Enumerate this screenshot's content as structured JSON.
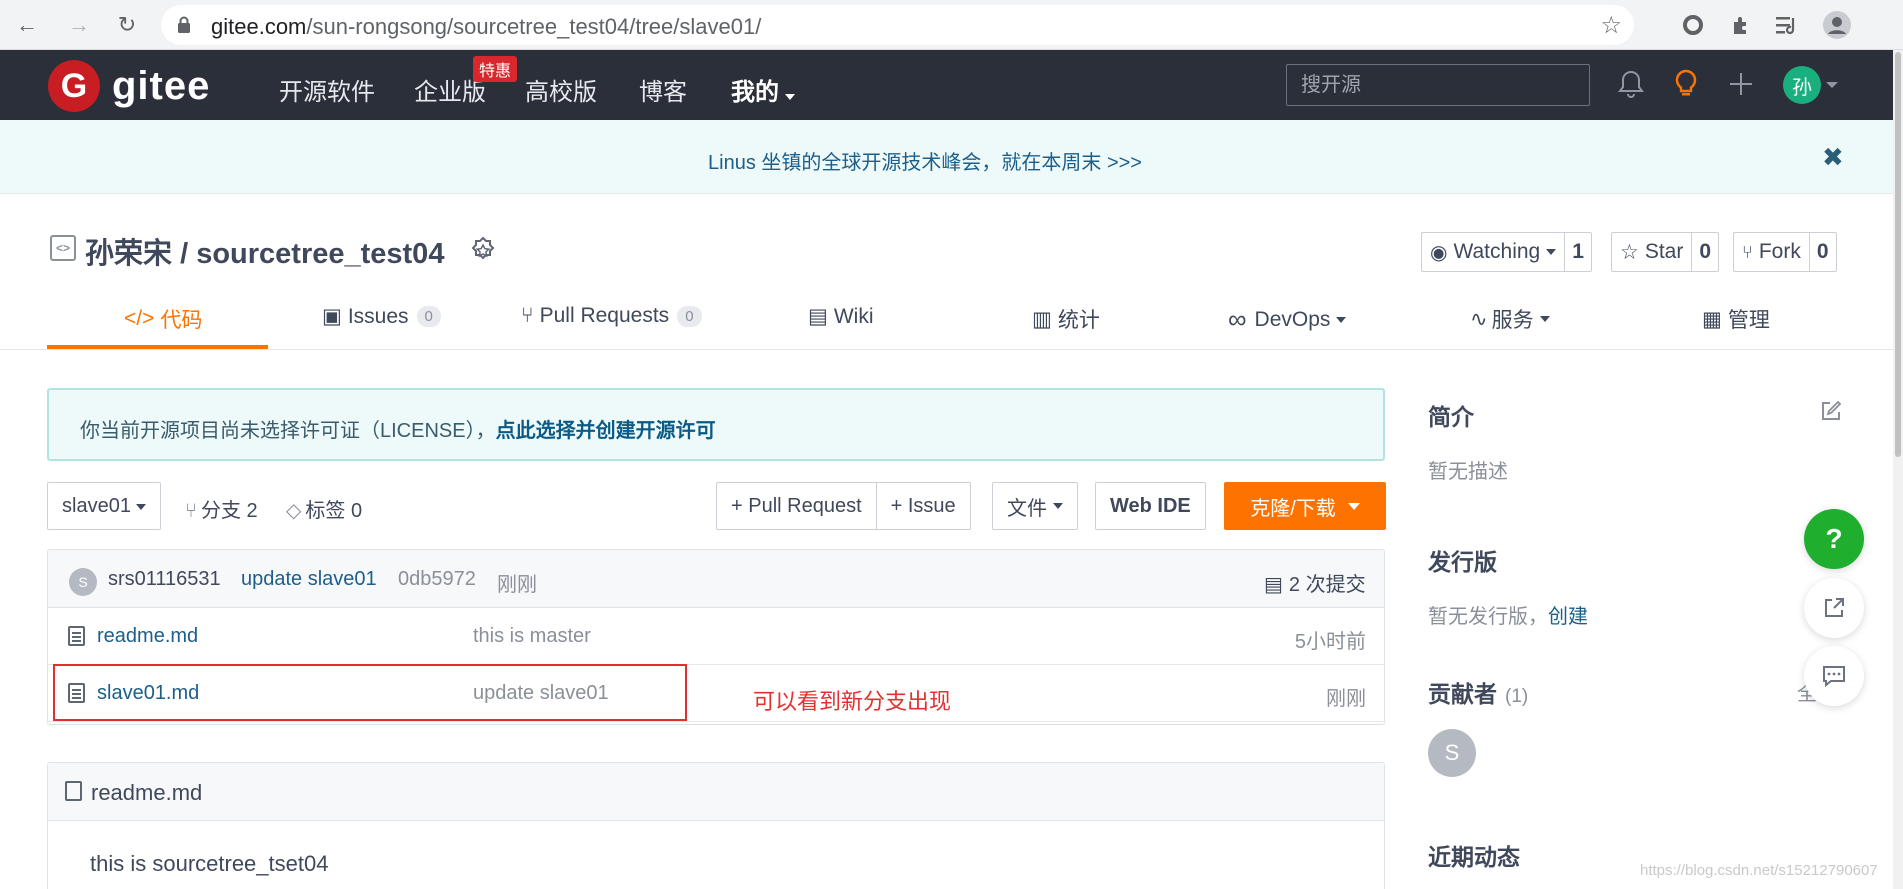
{
  "browser": {
    "url_host": "gitee.com",
    "url_path": "/sun-rongsong/sourcetree_test04/tree/slave01/"
  },
  "header": {
    "logo_text": "gitee",
    "logo_letter": "G",
    "nav": [
      "开源软件",
      "企业版",
      "高校版",
      "博客",
      "我的"
    ],
    "hot_badge": "特惠",
    "search_placeholder": "搜开源",
    "avatar_text": "孙"
  },
  "banner": {
    "text": "Linus 坐镇的全球开源技术峰会，就在本周末 >>>",
    "close": "✖"
  },
  "repo": {
    "owner": "孙荣宋",
    "name": "sourcetree_test04",
    "watch_label": "Watching",
    "watch_count": "1",
    "star_label": "Star",
    "star_count": "0",
    "fork_label": "Fork",
    "fork_count": "0"
  },
  "tabs": {
    "code": "代码",
    "issues": "Issues",
    "issues_count": "0",
    "pulls": "Pull Requests",
    "pulls_count": "0",
    "wiki": "Wiki",
    "stats": "统计",
    "devops": "DevOps",
    "services": "服务",
    "manage": "管理"
  },
  "notice": {
    "text": "你当前开源项目尚未选择许可证（LICENSE），",
    "link": "点此选择并创建开源许可"
  },
  "toolbar": {
    "branch": "slave01",
    "branches": "分支 2",
    "tags": "标签 0",
    "pull_request": "+ Pull Request",
    "issue": "+ Issue",
    "file": "文件",
    "web_ide": "Web IDE",
    "clone": "克隆/下载"
  },
  "commit": {
    "avatar": "S",
    "author": "srs01116531",
    "message": "update slave01",
    "hash": "0db5972",
    "time": "刚刚",
    "count": "2 次提交"
  },
  "files": [
    {
      "name": "readme.md",
      "message": "this is master",
      "time": "5小时前"
    },
    {
      "name": "slave01.md",
      "message": "update slave01",
      "time": "刚刚"
    }
  ],
  "annotation": "可以看到新分支出现",
  "readme": {
    "title": "readme.md",
    "body": "this is sourcetree_tset04"
  },
  "sidebar": {
    "intro_title": "简介",
    "intro_text": "暂无描述",
    "release_title": "发行版",
    "release_text": "暂无发行版，",
    "release_link": "创建",
    "contrib_title": "贡献者",
    "contrib_count": "(1)",
    "contrib_avatar": "S",
    "activity_title": "近期动态",
    "partial_text": "全"
  },
  "watermark": "https://blog.csdn.net/s15212790607"
}
